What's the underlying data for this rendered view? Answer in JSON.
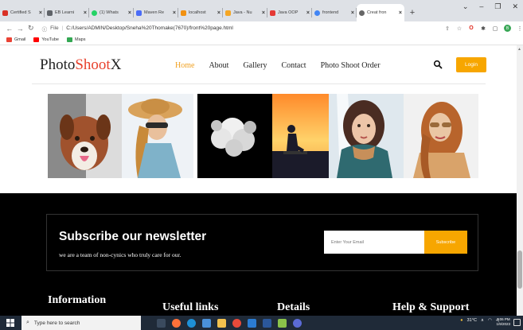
{
  "browser": {
    "tabs": [
      {
        "label": "Certified S",
        "color": "#d93025"
      },
      {
        "label": "EB Learni",
        "color": "#5f6368"
      },
      {
        "label": "(1) Whats",
        "color": "#25d366"
      },
      {
        "label": "Maven Re",
        "color": "#4a6cf7"
      },
      {
        "label": "localhost",
        "color": "#f29111"
      },
      {
        "label": "Java - Nu",
        "color": "#f5a623"
      },
      {
        "label": "Java OOP",
        "color": "#e53935"
      },
      {
        "label": "frontend",
        "color": "#4285f4"
      },
      {
        "label": "Creat fron",
        "color": "#666666"
      }
    ],
    "address_prefix": "File",
    "url": "C:/Users/ADMIN/Desktop/Sneha%20Thomake(7670)/front%20page.html",
    "bookmarks": [
      {
        "label": "Gmail",
        "color": "#ea4335"
      },
      {
        "label": "YouTube",
        "color": "#ff0000"
      },
      {
        "label": "Maps",
        "color": "#34a853"
      }
    ],
    "profile_initial": "B"
  },
  "site": {
    "logo_part1": "Photo",
    "logo_part2": "Shoot",
    "logo_part3": "X",
    "nav": [
      "Home",
      "About",
      "Gallery",
      "Contact",
      "Photo Shoot Order"
    ],
    "login_label": "Login",
    "newsletter": {
      "title": "Subscribe our newsletter",
      "subtitle": "we are a team of non-cynics who truly care for our.",
      "email_placeholder": "Enter Your Email",
      "button_label": "Subscribe"
    },
    "footer": {
      "headings": [
        "Information",
        "Useful links",
        "Details",
        "Help & Support"
      ]
    }
  },
  "taskbar": {
    "search_placeholder": "Type here to search",
    "temperature": "31°C",
    "time": "3:06 PM",
    "date": "1/9/2023"
  }
}
